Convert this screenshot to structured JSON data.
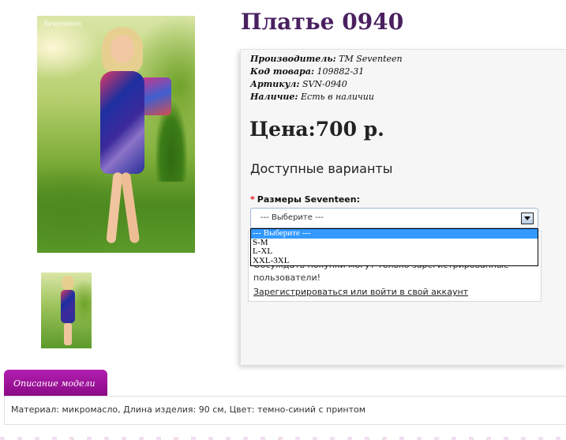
{
  "product": {
    "title": "Платье 0940",
    "watermark": "Seventeen",
    "meta": [
      {
        "label": "Производитель:",
        "value": "TM Seventeen"
      },
      {
        "label": "Код товара:",
        "value": "109882-31"
      },
      {
        "label": "Артикул:",
        "value": "SVN-0940"
      },
      {
        "label": "Наличие:",
        "value": "Есть в наличии"
      }
    ],
    "price": "Цена:700 р."
  },
  "options": {
    "heading": "Доступные варианты",
    "required_mark": "*",
    "size_label": "Размеры Seventeen:",
    "selected": "--- Выберите ---",
    "dropdown_options": [
      "--- Выберите ---",
      "S-M",
      "L-XL",
      "XXL-3XL"
    ]
  },
  "notice": {
    "text": "Обсуждать покупки могут только зарегистрированные пользователи!",
    "link": "Зарегистрироваться или войти в свой аккаунт"
  },
  "description": {
    "tab_label": "Описание модели",
    "text": "Материал: микромасло, Длина изделия: 90 см, Цвет: темно-синий с принтом"
  },
  "colors": {
    "title": "#4a2060",
    "tab": "#9c1499",
    "dropdown_highlight": "#3399ff",
    "required": "#e0191f"
  }
}
